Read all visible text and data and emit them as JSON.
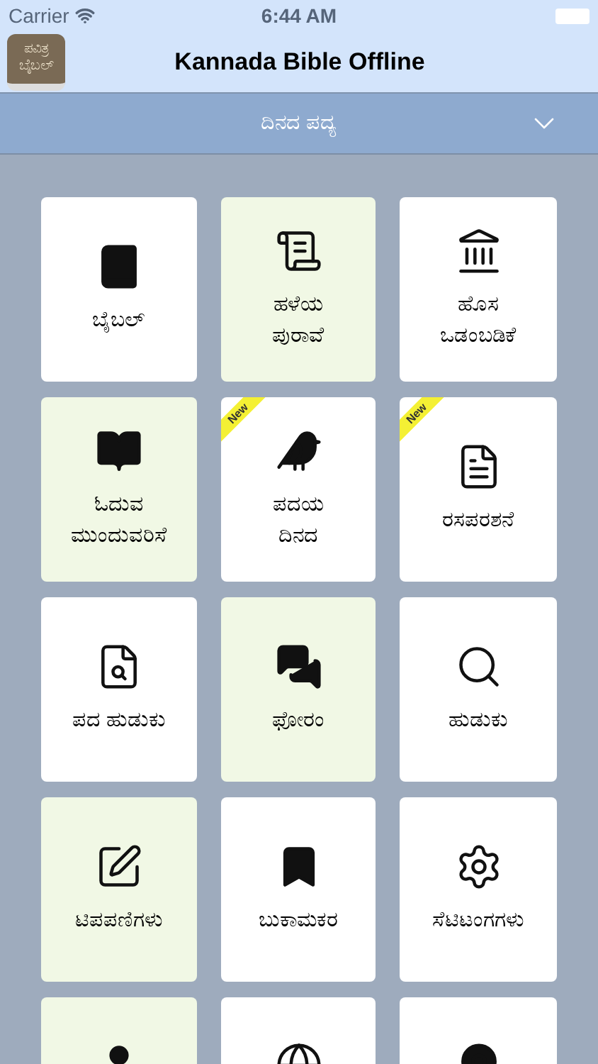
{
  "status_bar": {
    "carrier": "Carrier",
    "time": "6:44 AM"
  },
  "header": {
    "app_icon_lines": [
      "ಪವಿತ್ರ",
      "ಬೈಬಲ್"
    ],
    "title": "Kannada Bible Offline"
  },
  "verse_bar": {
    "label": "ದಿನದ ಪದ್ಯ",
    "expanded": false
  },
  "tiles": [
    {
      "lines": [
        "ಬೈಬಲ್"
      ],
      "highlighted": false
    },
    {
      "lines": [
        "ಹಳೆಯ",
        "ಪುರಾವೆ"
      ],
      "highlighted": true
    },
    {
      "lines": [
        "ಹೊಸ",
        "ಒಡಂಬಡಿಕೆ"
      ],
      "highlighted": false
    },
    {
      "lines": [
        "ಓದುವ",
        "ಮುಂದುವರಿಸೆ"
      ],
      "highlighted": true
    },
    {
      "lines": [
        "ಪದಯ",
        "ದಿನದ"
      ],
      "highlighted": false,
      "badge": "New"
    },
    {
      "lines": [
        "ರಸಪರಶನೆ"
      ],
      "highlighted": false,
      "badge": "New"
    },
    {
      "lines": [
        "ಪದ ಹುಡುಕು"
      ],
      "highlighted": false
    },
    {
      "lines": [
        "ಫೋರಂ"
      ],
      "highlighted": true
    },
    {
      "lines": [
        "ಹುಡುಕು"
      ],
      "highlighted": false
    },
    {
      "lines": [
        "ಟಿಪಪಣಿಗಳು"
      ],
      "highlighted": true
    },
    {
      "lines": [
        "ಬುಕಾಮಕರ"
      ],
      "highlighted": false
    },
    {
      "lines": [
        "ಸೆಟಿಟಂಗಗಳು"
      ],
      "highlighted": false
    },
    {
      "highlighted": true
    },
    {
      "highlighted": false
    },
    {
      "highlighted": false
    }
  ]
}
